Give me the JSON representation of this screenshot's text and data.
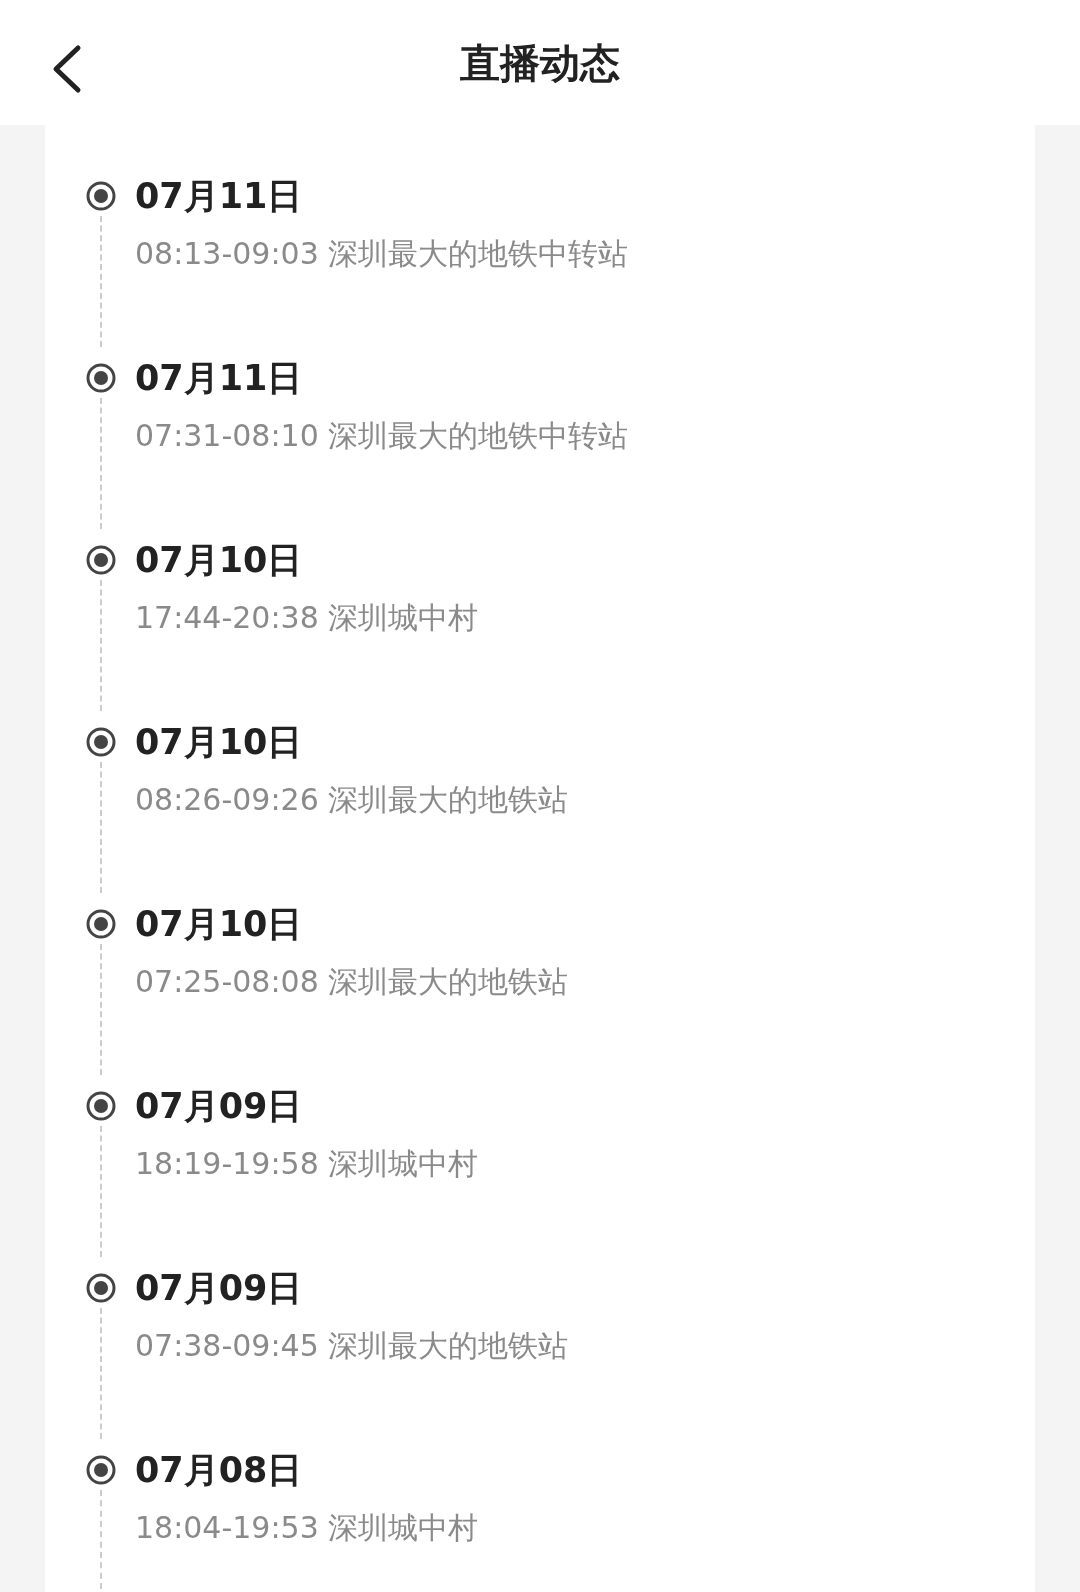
{
  "header": {
    "title": "直播动态"
  },
  "items": [
    {
      "date": "07月11日",
      "detail": "08:13-09:03 深圳最大的地铁中转站"
    },
    {
      "date": "07月11日",
      "detail": "07:31-08:10 深圳最大的地铁中转站"
    },
    {
      "date": "07月10日",
      "detail": "17:44-20:38 深圳城中村"
    },
    {
      "date": "07月10日",
      "detail": "08:26-09:26 深圳最大的地铁站"
    },
    {
      "date": "07月10日",
      "detail": "07:25-08:08 深圳最大的地铁站"
    },
    {
      "date": "07月09日",
      "detail": "18:19-19:58 深圳城中村"
    },
    {
      "date": "07月09日",
      "detail": "07:38-09:45 深圳最大的地铁站"
    },
    {
      "date": "07月08日",
      "detail": "18:04-19:53 深圳城中村"
    }
  ]
}
